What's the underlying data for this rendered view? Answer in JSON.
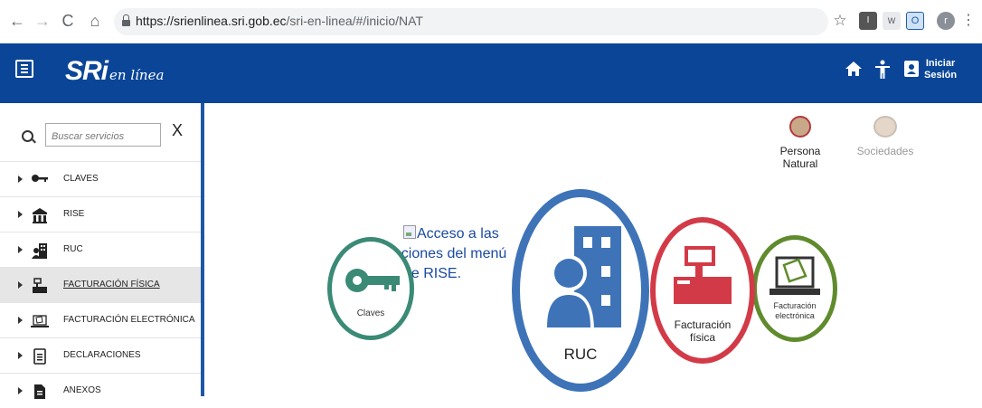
{
  "browser": {
    "url_host": "https://srienlinea.sri.gob.ec",
    "url_path": "/sri-en-linea/#/inicio/NAT",
    "extensions": [
      "I",
      "W",
      "O"
    ],
    "profile_initial": "r"
  },
  "header": {
    "logo_main": "SRi",
    "logo_sub": "en línea",
    "login_line1": "Iniciar",
    "login_line2": "Sesión",
    "bg_color": "#0a4598"
  },
  "sidebar": {
    "search_placeholder": "Buscar servicios",
    "close_label": "X",
    "items": [
      {
        "label": "CLAVES",
        "icon": "key-icon"
      },
      {
        "label": "RISE",
        "icon": "building-icon"
      },
      {
        "label": "RUC",
        "icon": "ruc-person-building-icon"
      },
      {
        "label": "FACTURACIÓN FÍSICA",
        "icon": "cash-register-icon"
      },
      {
        "label": "FACTURACIÓN ELECTRÓNICA",
        "icon": "laptop-invoice-icon"
      },
      {
        "label": "DECLARACIONES",
        "icon": "document-icon"
      },
      {
        "label": "ANEXOS",
        "icon": "file-icon"
      }
    ],
    "active_index": 3
  },
  "personas": {
    "natural": "Persona Natural",
    "sociedades": "Sociedades"
  },
  "main": {
    "broken_image_alt": "Acceso a las opciones del menú de RISE.",
    "broken_lines": [
      "Acceso a las",
      "opciones del menú",
      "de RISE."
    ],
    "circles": {
      "claves": "Claves",
      "ruc": "RUC",
      "fisica": [
        "Facturación",
        "física"
      ],
      "electronica": [
        "Facturación",
        "electrónica"
      ]
    },
    "colors": {
      "claves": "#3a8a76",
      "ruc": "#3e73b8",
      "fisica": "#d33a47",
      "electronica": "#5f8b2d"
    }
  }
}
